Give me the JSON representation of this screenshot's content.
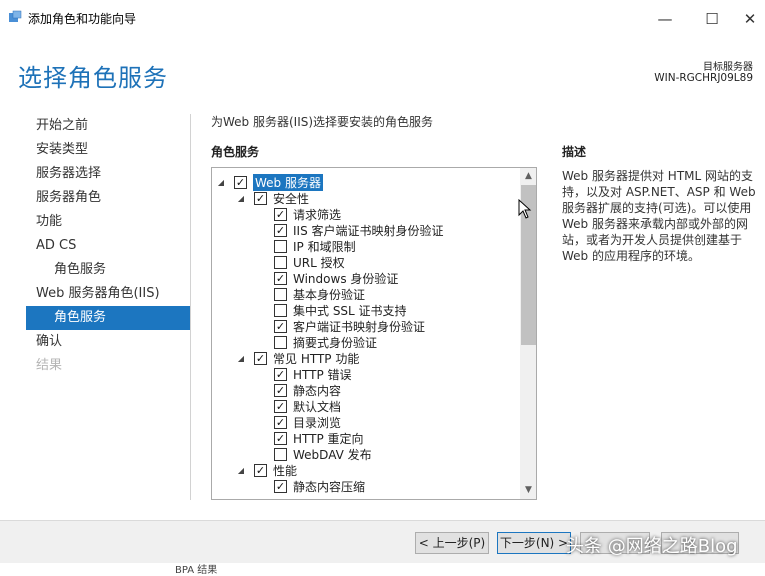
{
  "window": {
    "title": "添加角色和功能向导",
    "controls": {
      "minimize": "—",
      "maximize": "☐",
      "close": "✕"
    }
  },
  "header": {
    "page_title": "选择角色服务",
    "target_label": "目标服务器",
    "target_name": "WIN-RGCHRJ09L89"
  },
  "nav": {
    "items": [
      {
        "label": "开始之前",
        "state": "normal"
      },
      {
        "label": "安装类型",
        "state": "normal"
      },
      {
        "label": "服务器选择",
        "state": "normal"
      },
      {
        "label": "服务器角色",
        "state": "normal"
      },
      {
        "label": "功能",
        "state": "normal"
      },
      {
        "label": "AD CS",
        "state": "normal"
      },
      {
        "label": "角色服务",
        "state": "sub"
      },
      {
        "label": "Web 服务器角色(IIS)",
        "state": "normal"
      },
      {
        "label": "角色服务",
        "state": "active"
      },
      {
        "label": "确认",
        "state": "normal"
      },
      {
        "label": "结果",
        "state": "disabled"
      }
    ]
  },
  "main": {
    "intro": "为Web 服务器(IIS)选择要安装的角色服务",
    "section_header": "角色服务",
    "tree": [
      {
        "label": "Web 服务器",
        "level": 0,
        "expander": "◢",
        "checked": true,
        "highlight": true
      },
      {
        "label": "安全性",
        "level": 1,
        "expander": "◢",
        "checked": true
      },
      {
        "label": "请求筛选",
        "level": 2,
        "checked": true
      },
      {
        "label": "IIS 客户端证书映射身份验证",
        "level": 2,
        "checked": true
      },
      {
        "label": "IP 和域限制",
        "level": 2,
        "checked": false
      },
      {
        "label": "URL 授权",
        "level": 2,
        "checked": false
      },
      {
        "label": "Windows 身份验证",
        "level": 2,
        "checked": true
      },
      {
        "label": "基本身份验证",
        "level": 2,
        "checked": false
      },
      {
        "label": "集中式 SSL 证书支持",
        "level": 2,
        "checked": false
      },
      {
        "label": "客户端证书映射身份验证",
        "level": 2,
        "checked": true
      },
      {
        "label": "摘要式身份验证",
        "level": 2,
        "checked": false
      },
      {
        "label": "常见 HTTP 功能",
        "level": 1,
        "expander": "◢",
        "checked": true
      },
      {
        "label": "HTTP 错误",
        "level": 2,
        "checked": true
      },
      {
        "label": "静态内容",
        "level": 2,
        "checked": true
      },
      {
        "label": "默认文档",
        "level": 2,
        "checked": true
      },
      {
        "label": "目录浏览",
        "level": 2,
        "checked": true
      },
      {
        "label": "HTTP 重定向",
        "level": 2,
        "checked": true
      },
      {
        "label": "WebDAV 发布",
        "level": 2,
        "checked": false
      },
      {
        "label": "性能",
        "level": 1,
        "expander": "◢",
        "checked": true
      },
      {
        "label": "静态内容压缩",
        "level": 2,
        "checked": true
      }
    ],
    "scroll": {
      "up": "▲",
      "down": "▼"
    }
  },
  "description": {
    "header": "描述",
    "text": "Web 服务器提供对 HTML 网站的支持，以及对 ASP.NET、ASP 和 Web 服务器扩展的支持(可选)。可以使用 Web 服务器来承载内部或外部的网站，或者为开发人员提供创建基于 Web 的应用程序的环境。"
  },
  "footer": {
    "prev": "< 上一步(P)",
    "next": "下一步(N) >",
    "install": "",
    "cancel": "",
    "strip_text": "BPA 结果"
  },
  "watermark": "头条 @网络之路Blog",
  "colors": {
    "accent": "#1c76c0",
    "title": "#1e72b8"
  }
}
